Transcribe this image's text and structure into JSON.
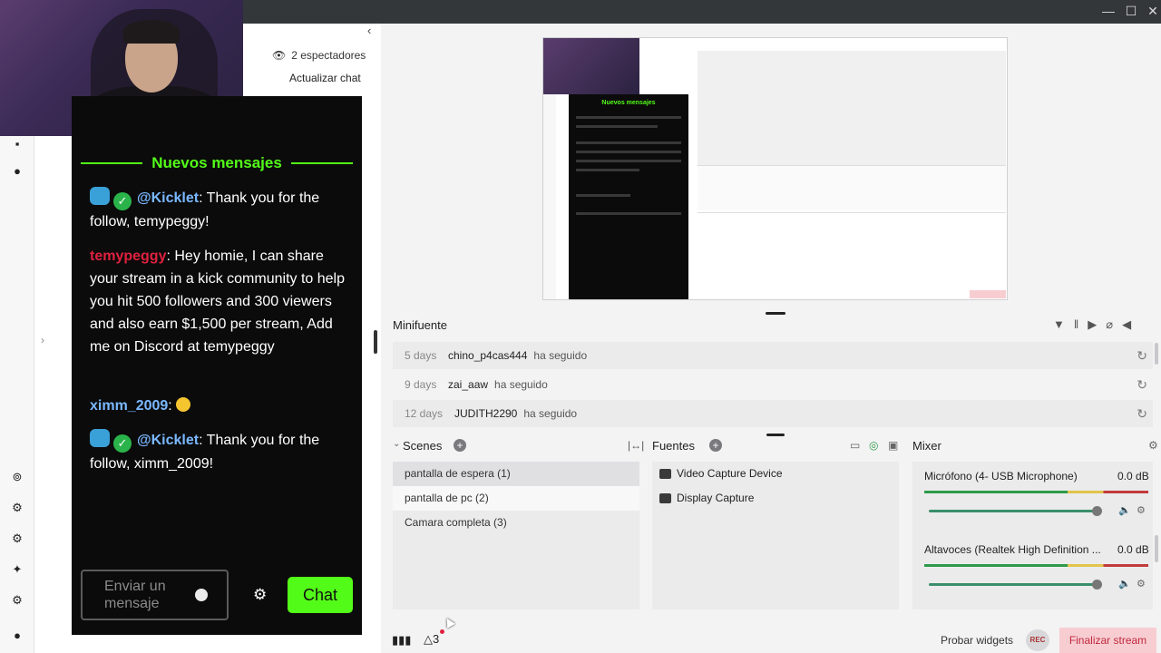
{
  "window": {
    "minimize": "—",
    "maximize": "☐",
    "close": "✕"
  },
  "sidebar": {
    "viewers": "2 espectadores",
    "refresh_chat": "Actualizar chat",
    "collapse": "‹",
    "expand": "›"
  },
  "chat": {
    "banner": "Nuevos mensajes",
    "messages": [
      {
        "user": "@Kicklet",
        "text": ": Thank you for the follow, temypeggy!"
      },
      {
        "user": "temypeggy",
        "text": ": Hey homie, I can share your stream in a kick community to help you hit 500 followers and 300 viewers and also earn $1,500 per stream, Add me on Discord at temypeggy"
      },
      {
        "user": "ximm_2009",
        "text": ": "
      },
      {
        "user": "@Kicklet",
        "text": ": Thank you for the follow, ximm_2009!"
      }
    ],
    "input_placeholder": "Enviar un mensaje",
    "send_label": "Chat"
  },
  "preview": {
    "banner": "Nuevos mensajes",
    "viewers": "2 espectadores",
    "refresh_chat": "Actualizar chat",
    "minifuente": "Minifuente",
    "scenes": "Scenes",
    "fuentes": "Fuentes",
    "mixer": "Mixer"
  },
  "minifuente": {
    "title": "Minifuente",
    "events": [
      {
        "when": "5 days",
        "user": "chino_p4cas444",
        "action": "ha seguido"
      },
      {
        "when": "9 days",
        "user": "zai_aaw",
        "action": "ha seguido"
      },
      {
        "when": "12 days",
        "user": "JUDITH2290",
        "action": "ha seguido"
      }
    ]
  },
  "scenes": {
    "title": "Scenes",
    "items": [
      "pantalla de espera (1)",
      "pantalla de pc (2)",
      "Camara completa (3)"
    ]
  },
  "sources": {
    "title": "Fuentes",
    "items": [
      "Video Capture Device",
      "Display Capture"
    ]
  },
  "mixer": {
    "title": "Mixer",
    "channels": [
      {
        "name": "Micrófono (4- USB Microphone)",
        "db": "0.0 dB",
        "level": 1.0
      },
      {
        "name": "Altavoces (Realtek High Definition ...",
        "db": "0.0 dB",
        "level": 1.0
      }
    ]
  },
  "bottom": {
    "warnings": "3",
    "test_widgets": "Probar widgets",
    "rec": "REC",
    "end_stream": "Finalizar stream"
  }
}
